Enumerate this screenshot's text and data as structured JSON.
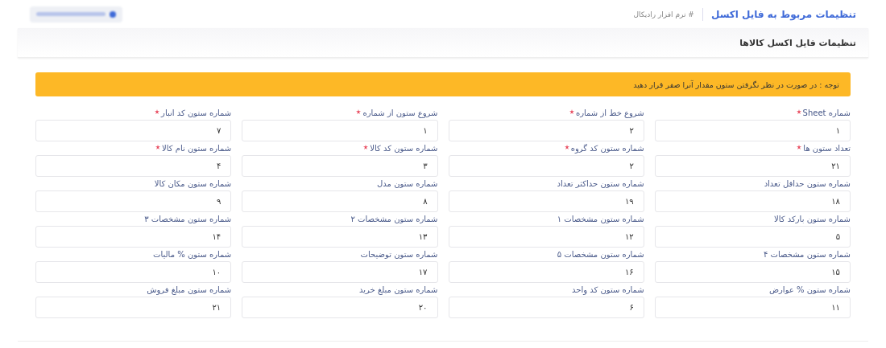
{
  "header": {
    "title": "تنظیمات مربوط به فایل اکسل",
    "breadcrumb": "# نرم افزار رادیکال"
  },
  "card": {
    "title": "تنظیمات فایل اکسل کالاها",
    "alert": "توجه : در صورت در نظر نگرفتن ستون مقدار آنرا صفر قرار دهید"
  },
  "fields": [
    {
      "label": "شماره Sheet",
      "value": "۱",
      "required": true
    },
    {
      "label": "شروع خط از شماره",
      "value": "۲",
      "required": true
    },
    {
      "label": "شروع ستون از شماره",
      "value": "۱",
      "required": true
    },
    {
      "label": "شماره ستون کد انبار",
      "value": "۷",
      "required": true
    },
    {
      "label": "تعداد ستون ها",
      "value": "۲۱",
      "required": true
    },
    {
      "label": "شماره ستون کد گروه",
      "value": "۲",
      "required": true
    },
    {
      "label": "شماره ستون کد کالا",
      "value": "۳",
      "required": true
    },
    {
      "label": "شماره ستون نام کالا",
      "value": "۴",
      "required": true
    },
    {
      "label": "شماره ستون حداقل تعداد",
      "value": "۱۸",
      "required": false
    },
    {
      "label": "شماره ستون حداکثر تعداد",
      "value": "۱۹",
      "required": false
    },
    {
      "label": "شماره ستون مدل",
      "value": "۸",
      "required": false
    },
    {
      "label": "شماره ستون مکان کالا",
      "value": "۹",
      "required": false
    },
    {
      "label": "شماره ستون بارکد کالا",
      "value": "۵",
      "required": false
    },
    {
      "label": "شماره ستون مشخصات ۱",
      "value": "۱۲",
      "required": false
    },
    {
      "label": "شماره ستون مشخصات ۲",
      "value": "۱۳",
      "required": false
    },
    {
      "label": "شماره ستون مشخصات ۳",
      "value": "۱۴",
      "required": false
    },
    {
      "label": "شماره ستون مشخصات ۴",
      "value": "۱۵",
      "required": false
    },
    {
      "label": "شماره ستون مشخصات ۵",
      "value": "۱۶",
      "required": false
    },
    {
      "label": "شماره ستون توضیحات",
      "value": "۱۷",
      "required": false
    },
    {
      "label": "شماره ستون % مالیات",
      "value": "۱۰",
      "required": false
    },
    {
      "label": "شماره ستون % عوارض",
      "value": "۱۱",
      "required": false
    },
    {
      "label": "شماره ستون کد واحد",
      "value": "۶",
      "required": false
    },
    {
      "label": "شماره ستون مبلغ خرید",
      "value": "۲۰",
      "required": false
    },
    {
      "label": "شماره ستون مبلغ فروش",
      "value": "۲۱",
      "required": false
    }
  ]
}
